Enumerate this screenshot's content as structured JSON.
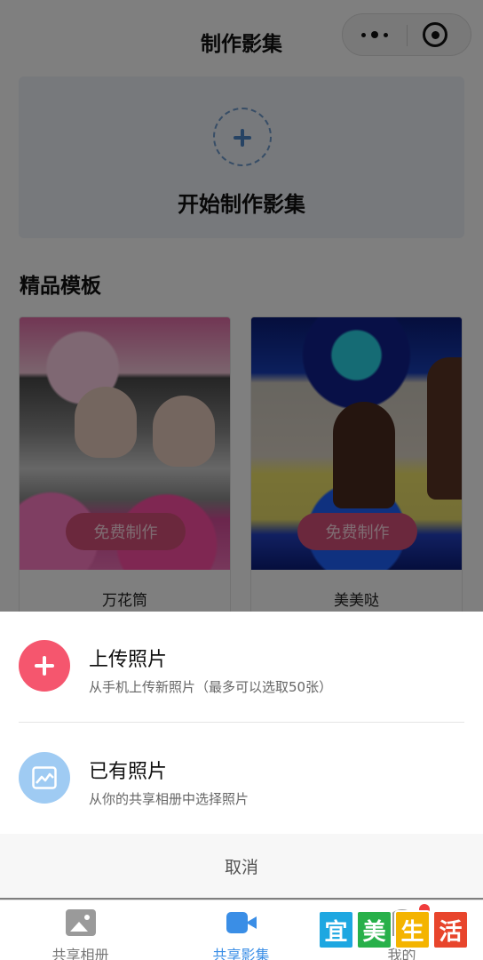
{
  "nav": {
    "title": "制作影集"
  },
  "create_card": {
    "label": "开始制作影集"
  },
  "section": {
    "title": "精品模板"
  },
  "templates": [
    {
      "name": "万花筒",
      "button": "免费制作"
    },
    {
      "name": "美美哒",
      "button": "免费制作"
    }
  ],
  "sheet": {
    "upload": {
      "title": "上传照片",
      "desc": "从手机上传新照片（最多可以选取50张）"
    },
    "existing": {
      "title": "已有照片",
      "desc": "从你的共享相册中选择照片"
    },
    "cancel": "取消"
  },
  "tabbar": {
    "tabs": [
      {
        "label": "共享相册",
        "icon": "photo-album-icon"
      },
      {
        "label": "共享影集",
        "icon": "video-camera-icon"
      },
      {
        "label": "我的",
        "icon": "profile-icon"
      }
    ],
    "active_index": 1
  },
  "watermark": {
    "chars": [
      "宜",
      "美",
      "生",
      "活"
    ]
  },
  "colors": {
    "accent": "#3a8ee6",
    "upload_icon": "#f5566e",
    "existing_icon": "#9fcbf3",
    "free_button": "#d7507a",
    "badge": "#f03c3c",
    "watermark": [
      "#1ea7e1",
      "#28b04a",
      "#f4b400",
      "#e8452c"
    ]
  }
}
